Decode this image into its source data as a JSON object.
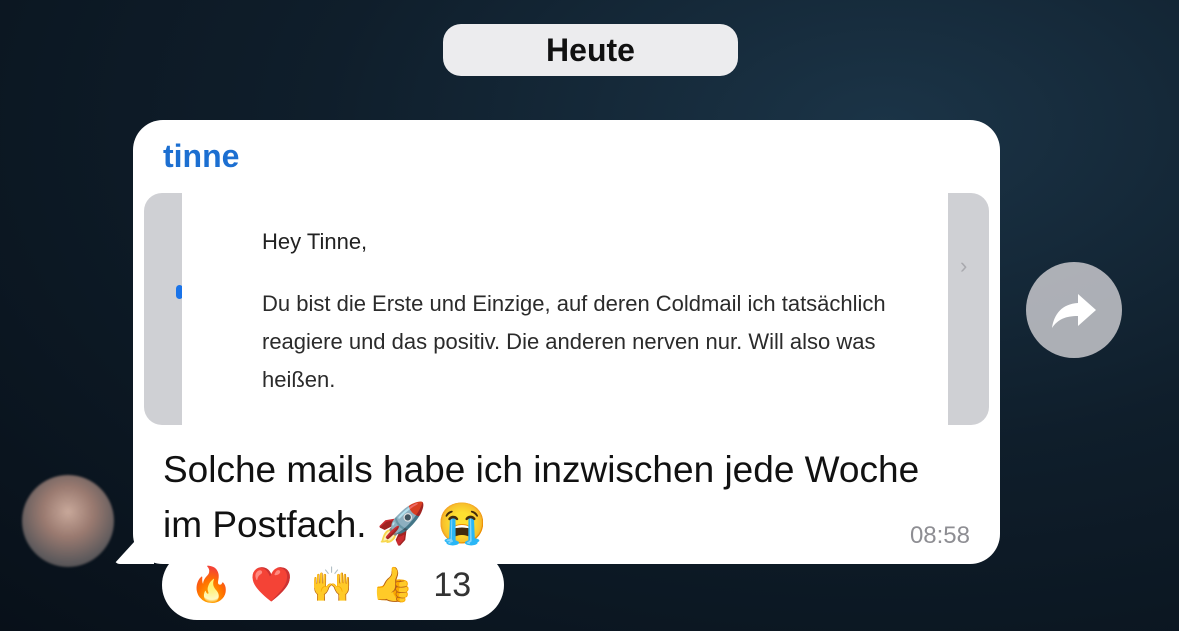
{
  "date_label": "Heute",
  "message": {
    "sender": "tinne",
    "screenshot": {
      "greeting": "Hey Tinne,",
      "body": "Du bist die Erste und Einzige, auf deren Coldmail ich tatsächlich reagiere und das positiv. Die anderen nerven nur. Will also was heißen."
    },
    "text": "Solche mails habe ich inzwischen jede Woche im Postfach.",
    "emojis": [
      "🚀",
      "😭"
    ],
    "time": "08:58"
  },
  "reactions": {
    "emojis": [
      "🔥",
      "❤️",
      "🙌",
      "👍"
    ],
    "count": "13"
  },
  "colors": {
    "sender": "#1c6fd1",
    "bubble": "#ffffff",
    "date_pill": "#ececee",
    "background": "#0f1e2b"
  },
  "icons": {
    "forward": "forward-arrow-icon",
    "avatar": "user-avatar"
  }
}
